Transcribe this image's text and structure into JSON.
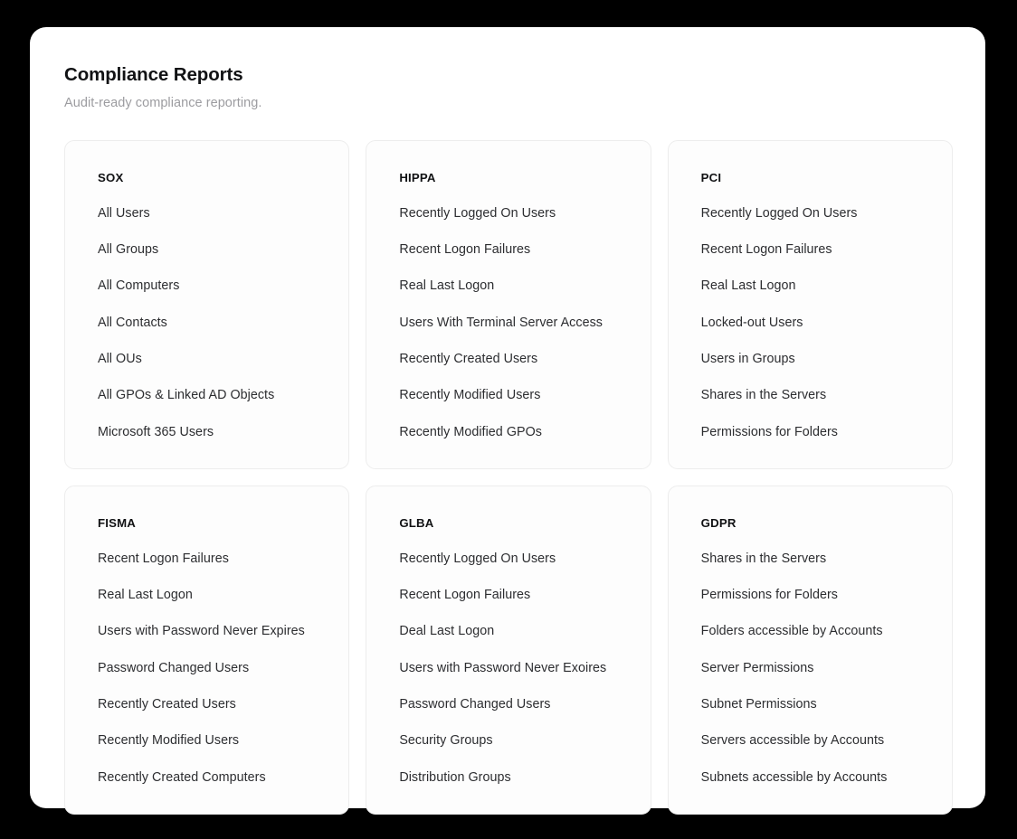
{
  "header": {
    "title": "Compliance Reports",
    "subtitle": "Audit-ready compliance reporting."
  },
  "colors": {
    "backdrop": "#000000",
    "panel": "#ffffff",
    "card_bg": "#fdfdfd",
    "card_border": "#ededed",
    "title_text": "#111214",
    "subtitle_text": "#9c9ca0",
    "item_text": "#2c2d30"
  },
  "cards": [
    {
      "name": "SOX",
      "items": [
        "All Users",
        "All Groups",
        "All Computers",
        "All Contacts",
        "All OUs",
        "All GPOs & Linked AD Objects",
        "Microsoft 365 Users"
      ]
    },
    {
      "name": "HIPPA",
      "items": [
        "Recently Logged On Users",
        "Recent Logon Failures",
        "Real Last Logon",
        "Users With Terminal Server Access",
        "Recently Created Users",
        "Recently Modified Users",
        "Recently Modified GPOs"
      ]
    },
    {
      "name": "PCI",
      "items": [
        "Recently Logged On Users",
        "Recent Logon Failures",
        "Real Last Logon",
        "Locked-out Users",
        "Users in Groups",
        "Shares in the Servers",
        "Permissions for Folders"
      ]
    },
    {
      "name": "FISMA",
      "items": [
        "Recent Logon Failures",
        "Real Last Logon",
        "Users with Password Never Expires",
        "Password Changed Users",
        "Recently Created Users",
        "Recently Modified Users",
        "Recently Created Computers"
      ]
    },
    {
      "name": "GLBA",
      "items": [
        "Recently Logged On Users",
        "Recent Logon Failures",
        "Deal Last Logon",
        "Users with Password Never Exoires",
        "Password Changed Users",
        "Security Groups",
        "Distribution Groups"
      ]
    },
    {
      "name": "GDPR",
      "items": [
        "Shares in the Servers",
        "Permissions for Folders",
        "Folders accessible by Accounts",
        "Server Permissions",
        "Subnet Permissions",
        "Servers accessible by Accounts",
        "Subnets accessible by Accounts"
      ]
    }
  ]
}
